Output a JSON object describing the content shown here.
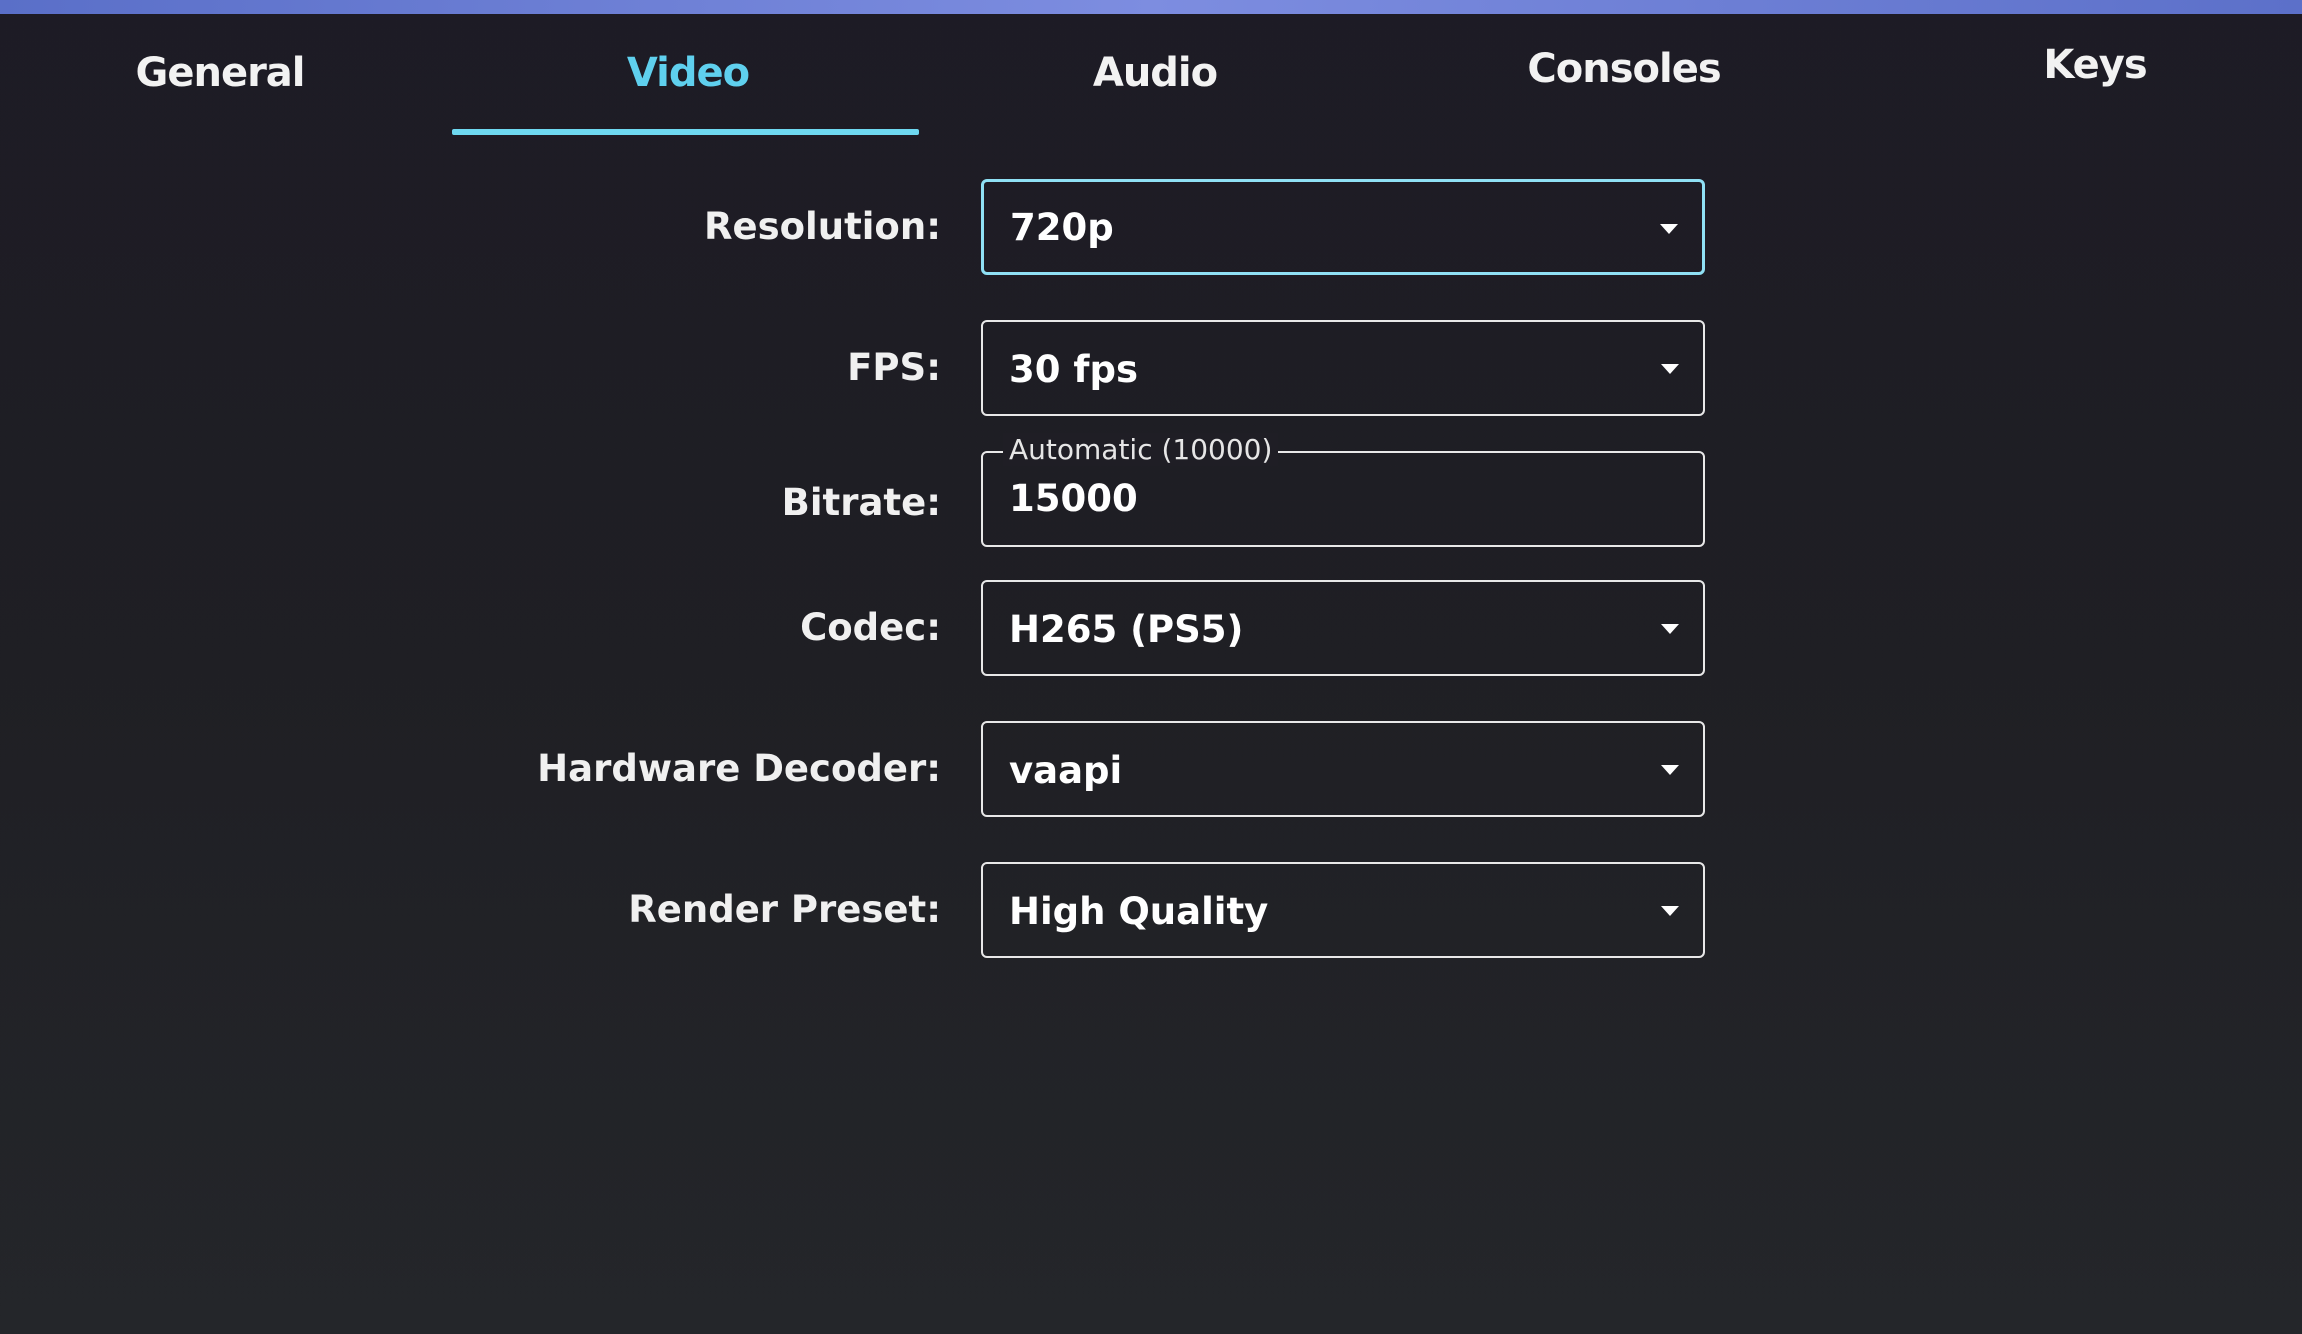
{
  "tabs": [
    {
      "label": "General",
      "active": false
    },
    {
      "label": "Video",
      "active": true
    },
    {
      "label": "Audio",
      "active": false
    },
    {
      "label": "Consoles",
      "active": false
    },
    {
      "label": "Keys",
      "active": false
    }
  ],
  "accent_color": "#5fd0ee",
  "settings": {
    "resolution": {
      "label": "Resolution:",
      "value": "720p"
    },
    "fps": {
      "label": "FPS:",
      "value": "30 fps"
    },
    "bitrate": {
      "label": "Bitrate:",
      "hint": "Automatic (10000)",
      "value": "15000"
    },
    "codec": {
      "label": "Codec:",
      "value": "H265 (PS5)"
    },
    "hardware_decoder": {
      "label": "Hardware Decoder:",
      "value": "vaapi"
    },
    "render_preset": {
      "label": "Render Preset:",
      "value": "High Quality"
    }
  }
}
